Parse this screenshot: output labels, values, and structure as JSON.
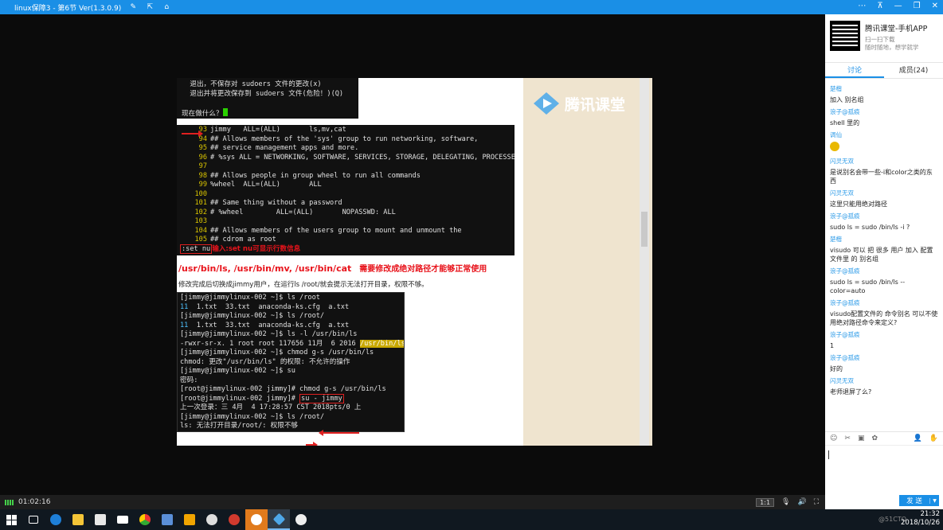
{
  "window": {
    "title": "linux保障3 - 第6节 Ver(1.3.0.9)",
    "controls": [
      "⋯",
      "⊼",
      "—",
      "❐",
      "✕"
    ]
  },
  "slide": {
    "logo_text": "腾讯课堂",
    "term1_lines": [
      "  退出，不保存对 sudoers 文件的更改(x)",
      "  退出并将更改保存到 sudoers 文件(危险！)(Q)",
      "",
      "现在做什么？"
    ],
    "term2_lines": [
      {
        "n": "93",
        "t": "jimmy   ALL=(ALL)       ls,mv,cat"
      },
      {
        "n": "94",
        "t": "## Allows members of the 'sys' group to run networking, software,"
      },
      {
        "n": "95",
        "t": "## service management apps and more."
      },
      {
        "n": "96",
        "t": "# %sys ALL = NETWORKING, SOFTWARE, SERVICES, STORAGE, DELEGATING, PROCESSES,"
      },
      {
        "n": "97",
        "t": ""
      },
      {
        "n": "98",
        "t": "## Allows people in group wheel to run all commands"
      },
      {
        "n": "99",
        "t": "%wheel  ALL=(ALL)       ALL"
      },
      {
        "n": "100",
        "t": ""
      },
      {
        "n": "101",
        "t": "## Same thing without a password"
      },
      {
        "n": "102",
        "t": "# %wheel        ALL=(ALL)       NOPASSWD: ALL"
      },
      {
        "n": "103",
        "t": ""
      },
      {
        "n": "104",
        "t": "## Allows members of the users group to mount and unmount the"
      },
      {
        "n": "105",
        "t": "## cdrom as root"
      }
    ],
    "setnu_cmd": ":set nu",
    "setnu_note": "输入:set nu可显示行数信息",
    "heading": "/usr/bin/ls, /usr/bin/mv, /usr/bin/cat",
    "heading_note": "需要修改成绝对路径才能够正常使用",
    "paragraph": "修改完成后切换成jimmy用户，在运行ls /root/就会提示无法打开目录，权限不够。",
    "term3": {
      "l1": "[jimmy@jimmylinux-002 ~]$ ls /root",
      "l2a": "11",
      "l2b": "  1.txt  33.txt  anaconda-ks.cfg  a.txt",
      "l3": "[jimmy@jimmylinux-002 ~]$ ls /root/",
      "l4a": "11",
      "l4b": "  1.txt  33.txt  anaconda-ks.cfg  a.txt",
      "l5": "[jimmy@jimmylinux-002 ~]$ ls -l /usr/bin/ls",
      "l6a": "-rwxr-sr-x. 1 root root 117656 11月  6 2016 ",
      "l6b": "/usr/bin/ls",
      "l7": "[jimmy@jimmylinux-002 ~]$ chmod g-s /usr/bin/ls",
      "l8": "chmod: 更改\"/usr/bin/ls\" 的权限: 不允许的操作",
      "l9": "[jimmy@jimmylinux-002 ~]$ su",
      "l10": "密码:",
      "l11": "[root@jimmylinux-002 jimmy]# chmod g-s /usr/bin/ls",
      "l12a": "[root@jimmylinux-002 jimmy]# ",
      "l12b": "su - jimmy",
      "l13": "上一次登录：三 4月  4 17:28:57 CST 2018pts/0 上",
      "l14": "[jimmy@jimmylinux-002 ~]$ ls /root/",
      "l15": "ls: 无法打开目录/root/: 权限不够"
    }
  },
  "player": {
    "elapsed": "01:02:16",
    "ratio": "1:1"
  },
  "sidebar": {
    "app_title": "腾讯课堂-手机APP",
    "app_sub1": "扫一扫下载",
    "app_sub2": "随时随地，想学就学",
    "tab_discuss": "讨论",
    "tab_members": "成员(24)",
    "messages": [
      {
        "name": "楚楷",
        "body": "加入 别名组"
      },
      {
        "name": "浪子@孤痕",
        "body": "shell 里的"
      },
      {
        "name": "调仙",
        "body": ""
      },
      {
        "name": "闪灵无双",
        "body": "是说别名会带一些-i和color之类的东西"
      },
      {
        "name": "闪灵无双",
        "body": "这里只能用绝对路径"
      },
      {
        "name": "浪子@孤痕",
        "body": "sudo ls = sudo /bin/ls -i ?"
      },
      {
        "name": "楚楷",
        "body": "visudo 可以 把 很多 用户 加入 配置文件里 的 别名组"
      },
      {
        "name": "浪子@孤痕",
        "body": "sudo ls = sudo /bin/ls --color=auto"
      },
      {
        "name": "浪子@孤痕",
        "body": "visudo配置文件的 命令别名 可以不使用绝对路径命令来定义?"
      },
      {
        "name": "浪子@孤痕",
        "body": "1"
      },
      {
        "name": "浪子@孤痕",
        "body": "好的"
      },
      {
        "name": "闪灵无双",
        "body": "老师退屏了么?"
      }
    ],
    "send_label": "发 送",
    "send_dropdown": "▼"
  },
  "taskbar": {
    "time": "21:32",
    "date": "2018/10/26",
    "watermark": "@51CTO"
  },
  "colors": {
    "accent": "#1a8fe6",
    "red": "#e8131b",
    "slide_bg": "#efe4cf"
  }
}
